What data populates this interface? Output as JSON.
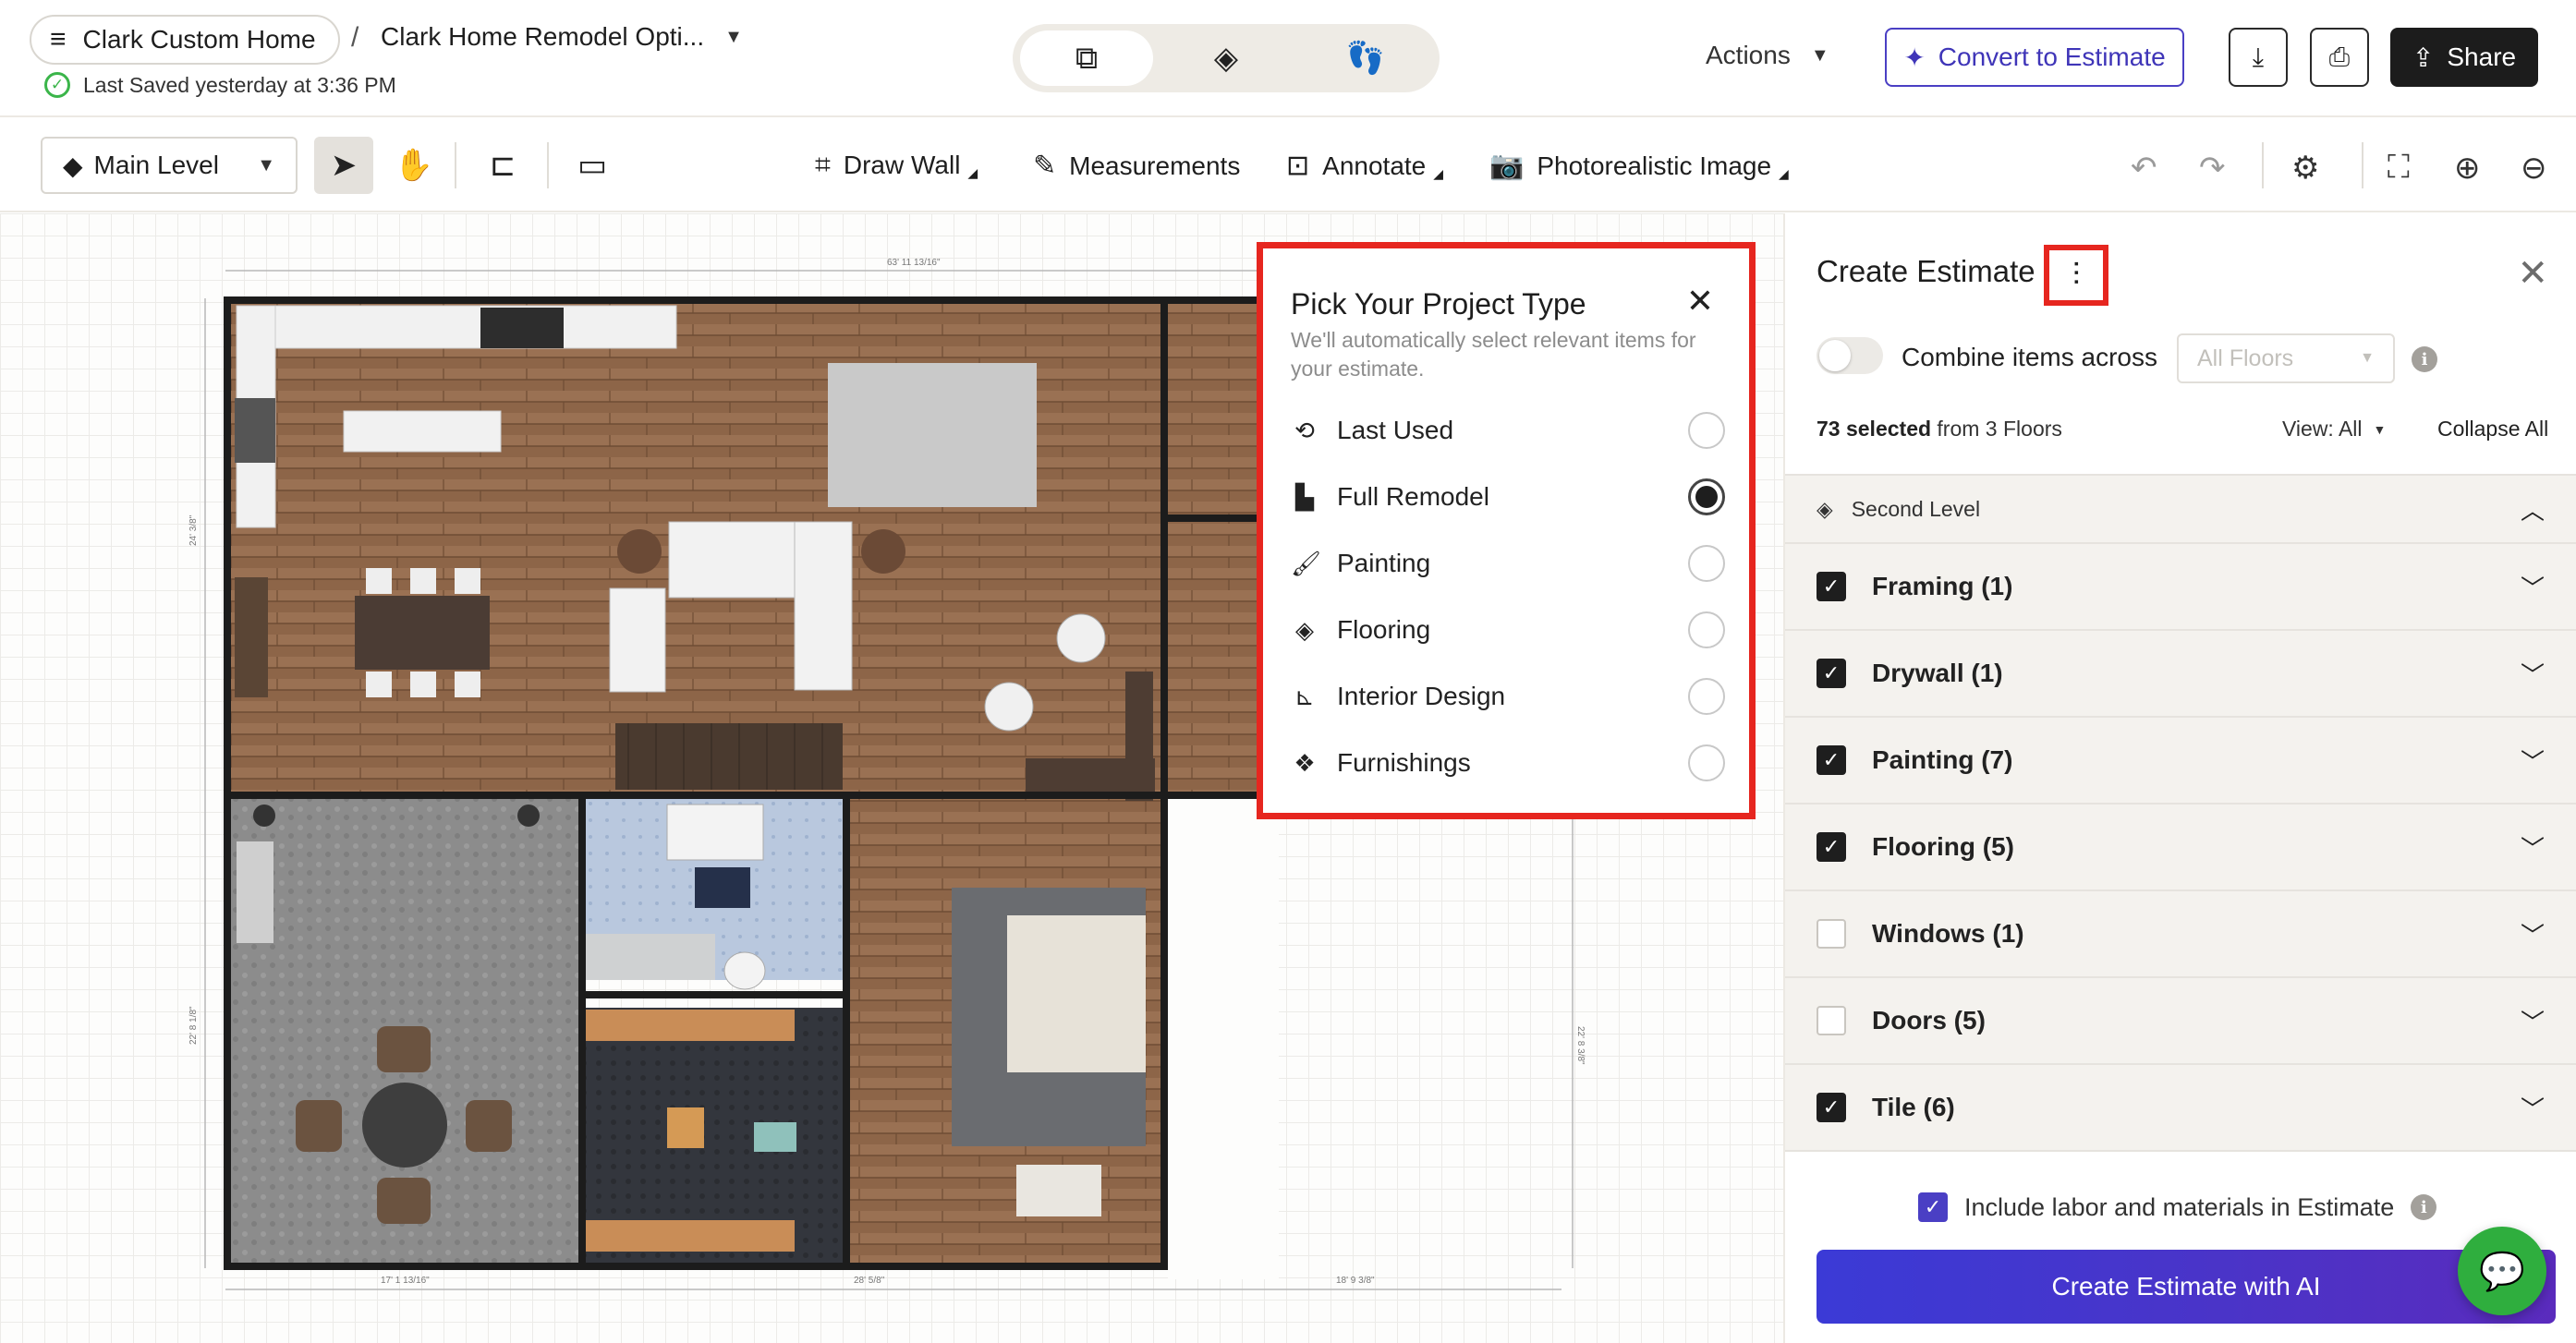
{
  "header": {
    "project_name": "Clark Custom Home",
    "separator": "/",
    "design_name": "Clark Home Remodel Opti...",
    "saved_status": "Last Saved yesterday at 3:36 PM",
    "actions_label": "Actions",
    "convert_label": "Convert to Estimate",
    "share_label": "Share"
  },
  "toolbar": {
    "level": "Main Level",
    "draw_wall": "Draw Wall",
    "measurements": "Measurements",
    "annotate": "Annotate",
    "photorealistic": "Photorealistic Image"
  },
  "floorplan": {
    "dim_top": "63' 11 13/16\"",
    "dim_left_upper": "24' 3/8\"",
    "dim_left_lower": "22' 8 1/8\"",
    "dim_right": "22' 8 3/8\"",
    "dim_bottom_1": "17' 1 13/16\"",
    "dim_bottom_2": "28' 5/8\"",
    "dim_bottom_3": "18' 9 3/8\""
  },
  "project_type_popup": {
    "title": "Pick Your Project Type",
    "subtitle": "We'll automatically select relevant items for your estimate.",
    "options": [
      {
        "label": "Last Used",
        "icon": "history-icon",
        "selected": false
      },
      {
        "label": "Full Remodel",
        "icon": "building-icon",
        "selected": true
      },
      {
        "label": "Painting",
        "icon": "paint-brush-icon",
        "selected": false
      },
      {
        "label": "Flooring",
        "icon": "layers-icon",
        "selected": false
      },
      {
        "label": "Interior Design",
        "icon": "design-icon",
        "selected": false
      },
      {
        "label": "Furnishings",
        "icon": "furnishings-icon",
        "selected": false
      }
    ]
  },
  "estimate_panel": {
    "title": "Create Estimate",
    "combine_label": "Combine items across",
    "floors_placeholder": "All Floors",
    "selected_count": "73 selected",
    "selected_from": "from 3 Floors",
    "view_label": "View: All",
    "collapse_all": "Collapse All",
    "level_name": "Second Level",
    "categories": [
      {
        "label": "Framing (1)",
        "checked": true
      },
      {
        "label": "Drywall (1)",
        "checked": true
      },
      {
        "label": "Painting (7)",
        "checked": true
      },
      {
        "label": "Flooring (5)",
        "checked": true
      },
      {
        "label": "Windows (1)",
        "checked": false
      },
      {
        "label": "Doors (5)",
        "checked": false
      },
      {
        "label": "Tile (6)",
        "checked": true
      }
    ],
    "include_label": "Include labor and materials in Estimate",
    "create_button": "Create Estimate with AI"
  },
  "colors": {
    "accent": "#4a3fc4",
    "highlight_red": "#e6261f",
    "saved_green": "#3bb54a",
    "chat_green": "#2fae3e"
  }
}
